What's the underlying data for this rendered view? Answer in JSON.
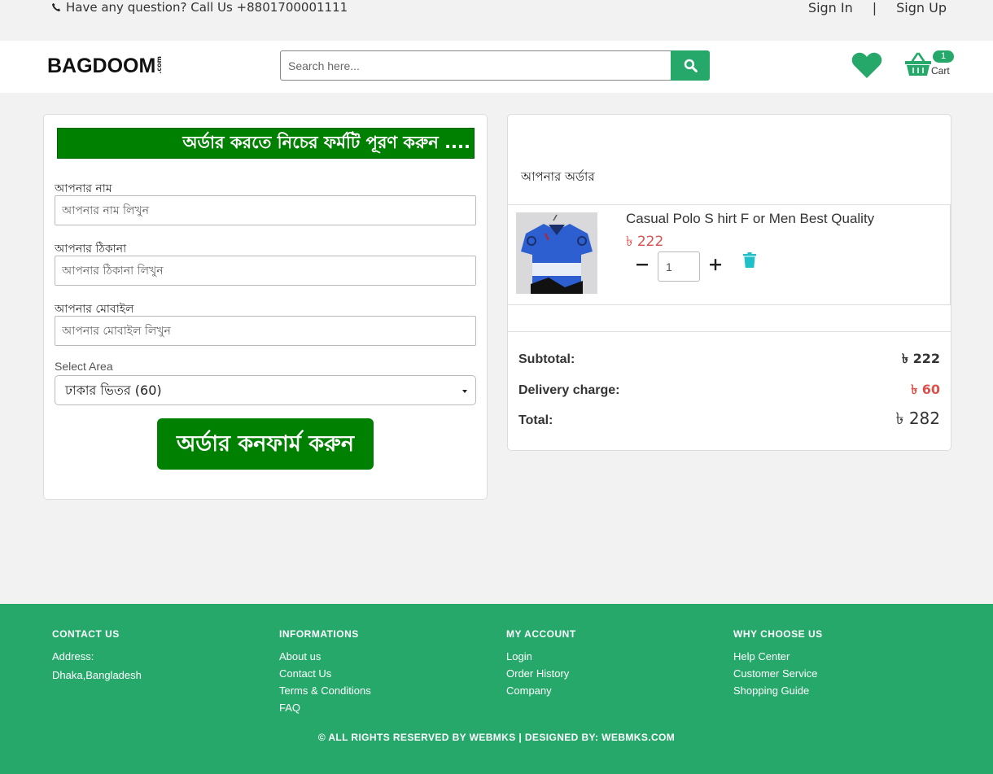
{
  "topbar": {
    "contact_text": "Have any question? Call Us +8801700001111",
    "sign_in": "Sign In",
    "separator": "|",
    "sign_up": "Sign Up"
  },
  "header": {
    "logo_text": "BAGDOOM",
    "logo_suffix": ".com",
    "search_placeholder": "Search here...",
    "cart_count": "1",
    "cart_label": "Cart"
  },
  "form": {
    "banner": "অর্ডার করতে নিচের ফর্মটি পূরণ করুন ....",
    "name_label": "আপনার নাম",
    "name_placeholder": "আপনার নাম লিখুন",
    "address_label": "আপনার ঠিকানা",
    "address_placeholder": "আপনার ঠিকানা লিখুন",
    "mobile_label": "আপনার মোবাইল",
    "mobile_placeholder": "আপনার মোবাইল লিখুন",
    "area_label": "Select Area",
    "area_value": "ঢাকার ভিতর (60)",
    "confirm_label": "অর্ডার কনফার্ম করুন"
  },
  "order": {
    "heading": "আপনার অর্ডার",
    "item_name": "Casual Polo S hirt F or Men Best Quality",
    "item_price": "৳ 222",
    "quantity": "1",
    "subtotal_label": "Subtotal:",
    "subtotal_value": "৳ 222",
    "delivery_label": "Delivery charge:",
    "delivery_value": "৳ 60",
    "total_label": "Total:",
    "total_value": "৳ 282"
  },
  "footer": {
    "contact": {
      "heading": "CONTACT US",
      "address_label": "Address:",
      "address": "Dhaka,Bangladesh"
    },
    "informations": {
      "heading": "INFORMATIONS",
      "links": [
        "About us",
        "Contact Us",
        "Terms & Conditions",
        "FAQ"
      ]
    },
    "account": {
      "heading": "MY ACCOUNT",
      "links": [
        "Login",
        "Order History",
        "Company"
      ]
    },
    "why": {
      "heading": "WHY CHOOSE US",
      "links": [
        "Help Center",
        "Customer Service",
        "Shopping Guide"
      ]
    },
    "copyright": "© ALL RIGHTS RESERVED BY WEBMKS | DESIGNED BY: WEBMKS.COM"
  },
  "colors": {
    "brand_green": "#26a86b",
    "form_green": "#008000",
    "price_red": "#d9534f",
    "trash_teal": "#20c0c8"
  }
}
